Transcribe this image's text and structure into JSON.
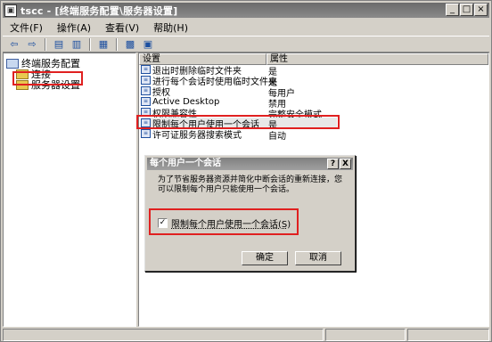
{
  "window": {
    "title": "tscc - [终端服务配置\\服务器设置]",
    "icon": "console-icon"
  },
  "menu": [
    "文件(F)",
    "操作(A)",
    "查看(V)",
    "帮助(H)"
  ],
  "toolbar": [
    "back-icon",
    "forward-icon",
    "up-folder-icon",
    "show-tree-icon",
    "export-icon",
    "help-icon",
    "properties-icon"
  ],
  "tree": {
    "root": "终端服务配置",
    "items": [
      "连接",
      "服务器设置"
    ]
  },
  "list": {
    "headers": [
      "设置",
      "属性"
    ],
    "rows": [
      {
        "name": "退出时删除临时文件夹",
        "value": "是"
      },
      {
        "name": "进行每个会话时使用临时文件夹",
        "value": "是"
      },
      {
        "name": "授权",
        "value": "每用户"
      },
      {
        "name": "Active Desktop",
        "value": "禁用"
      },
      {
        "name": "权限兼容性",
        "value": "完整安全模式"
      },
      {
        "name": "限制每个用户使用一个会话",
        "value": "是"
      },
      {
        "name": "许可证服务器搜索模式",
        "value": "自动"
      }
    ]
  },
  "dialog": {
    "title": "每个用户一个会话",
    "help": "?",
    "close": "X",
    "text": "为了节省服务器资源并简化中断会话的重新连接，您可以限制每个用户只能使用一个会话。",
    "checkbox_label": "限制每个用户使用一个会话(S)",
    "checked": true,
    "ok": "确定",
    "cancel": "取消"
  },
  "accent": {
    "highlight": "#e02020"
  }
}
